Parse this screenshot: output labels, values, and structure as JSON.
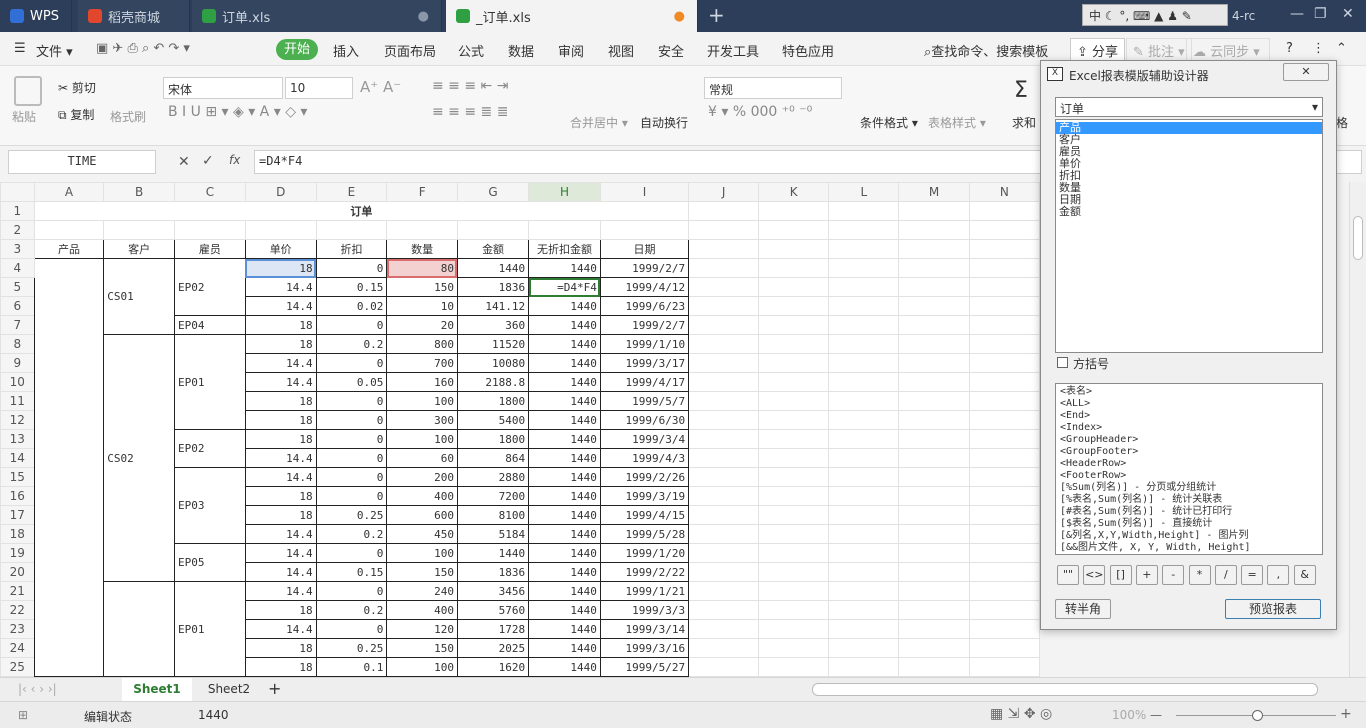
{
  "tabs": [
    {
      "label": "WPS",
      "color": "#2f6fd6"
    },
    {
      "label": "稻壳商城",
      "color": "#e0472c"
    },
    {
      "label": "订单.xls",
      "color": "#2ea043"
    },
    {
      "label": "_订单.xls",
      "color": "#2ea043"
    }
  ],
  "titlebar_right": "4-rc",
  "ime_label": "中",
  "menu": [
    "文件",
    "开始",
    "插入",
    "页面布局",
    "公式",
    "数据",
    "审阅",
    "视图",
    "安全",
    "开发工具",
    "特色应用"
  ],
  "search_label": "查找命令、搜索模板",
  "share_label": "分享",
  "comment_label": "批注",
  "cloud_label": "云同步",
  "ribbon": {
    "paste": "粘贴",
    "cut": "剪切",
    "copy": "复制",
    "format_painter": "格式刷",
    "font_name": "宋体",
    "font_size": "10",
    "merge": "合并居中",
    "wrap": "自动换行",
    "number_format": "常规",
    "cond_format": "条件格式",
    "table_style": "表格样式",
    "sum": "求和",
    "side_label": "格"
  },
  "formula": {
    "name_box": "TIME",
    "fx": "fx",
    "content": "=D4*F4"
  },
  "columns": [
    "A",
    "B",
    "C",
    "D",
    "E",
    "F",
    "G",
    "H",
    "I",
    "J",
    "K",
    "L",
    "M",
    "N"
  ],
  "sheet": {
    "title": "订单",
    "headers": [
      "产品",
      "客户",
      "雇员",
      "单价",
      "折扣",
      "数量",
      "金额",
      "无折扣金额",
      "日期"
    ],
    "customers": [
      "CS01",
      "CS02"
    ],
    "employees": [
      "EP02",
      "EP04",
      "EP01",
      "EP02",
      "EP03",
      "EP05",
      "EP01"
    ],
    "rows": [
      {
        "n": "4",
        "d": "18",
        "e": "0",
        "f": "80",
        "g": "1440",
        "h": "1440",
        "i": "1999/2/7"
      },
      {
        "n": "5",
        "d": "14.4",
        "e": "0.15",
        "f": "150",
        "g": "1836",
        "h": "=D4*F4",
        "i": "1999/4/12"
      },
      {
        "n": "6",
        "d": "14.4",
        "e": "0.02",
        "f": "10",
        "g": "141.12",
        "h": "1440",
        "i": "1999/6/23"
      },
      {
        "n": "7",
        "d": "18",
        "e": "0",
        "f": "20",
        "g": "360",
        "h": "1440",
        "i": "1999/2/7"
      },
      {
        "n": "8",
        "d": "18",
        "e": "0.2",
        "f": "800",
        "g": "11520",
        "h": "1440",
        "i": "1999/1/10"
      },
      {
        "n": "9",
        "d": "14.4",
        "e": "0",
        "f": "700",
        "g": "10080",
        "h": "1440",
        "i": "1999/3/17"
      },
      {
        "n": "10",
        "d": "14.4",
        "e": "0.05",
        "f": "160",
        "g": "2188.8",
        "h": "1440",
        "i": "1999/4/17"
      },
      {
        "n": "11",
        "d": "18",
        "e": "0",
        "f": "100",
        "g": "1800",
        "h": "1440",
        "i": "1999/5/7"
      },
      {
        "n": "12",
        "d": "18",
        "e": "0",
        "f": "300",
        "g": "5400",
        "h": "1440",
        "i": "1999/6/30"
      },
      {
        "n": "13",
        "d": "18",
        "e": "0",
        "f": "100",
        "g": "1800",
        "h": "1440",
        "i": "1999/3/4"
      },
      {
        "n": "14",
        "d": "14.4",
        "e": "0",
        "f": "60",
        "g": "864",
        "h": "1440",
        "i": "1999/4/3"
      },
      {
        "n": "15",
        "d": "14.4",
        "e": "0",
        "f": "200",
        "g": "2880",
        "h": "1440",
        "i": "1999/2/26"
      },
      {
        "n": "16",
        "d": "18",
        "e": "0",
        "f": "400",
        "g": "7200",
        "h": "1440",
        "i": "1999/3/19"
      },
      {
        "n": "17",
        "d": "18",
        "e": "0.25",
        "f": "600",
        "g": "8100",
        "h": "1440",
        "i": "1999/4/15"
      },
      {
        "n": "18",
        "d": "14.4",
        "e": "0.2",
        "f": "450",
        "g": "5184",
        "h": "1440",
        "i": "1999/5/28"
      },
      {
        "n": "19",
        "d": "14.4",
        "e": "0",
        "f": "100",
        "g": "1440",
        "h": "1440",
        "i": "1999/1/20"
      },
      {
        "n": "20",
        "d": "14.4",
        "e": "0.15",
        "f": "150",
        "g": "1836",
        "h": "1440",
        "i": "1999/2/22"
      },
      {
        "n": "21",
        "d": "14.4",
        "e": "0",
        "f": "240",
        "g": "3456",
        "h": "1440",
        "i": "1999/1/21"
      },
      {
        "n": "22",
        "d": "18",
        "e": "0.2",
        "f": "400",
        "g": "5760",
        "h": "1440",
        "i": "1999/3/3"
      },
      {
        "n": "23",
        "d": "14.4",
        "e": "0",
        "f": "120",
        "g": "1728",
        "h": "1440",
        "i": "1999/3/14"
      },
      {
        "n": "24",
        "d": "18",
        "e": "0.25",
        "f": "150",
        "g": "2025",
        "h": "1440",
        "i": "1999/3/16"
      },
      {
        "n": "25",
        "d": "18",
        "e": "0.1",
        "f": "100",
        "g": "1620",
        "h": "1440",
        "i": "1999/5/27"
      }
    ]
  },
  "sheet_tabs": [
    "Sheet1",
    "Sheet2"
  ],
  "status": {
    "mode": "编辑状态",
    "value": "1440",
    "zoom": "100%"
  },
  "dialog": {
    "title": "Excel报表模版辅助设计器",
    "table_select": "订单",
    "fields": [
      "产品",
      "客户",
      "雇员",
      "单价",
      "折扣",
      "数量",
      "日期",
      "金额"
    ],
    "bracket_label": "方括号",
    "templates": [
      "<表名>",
      "<ALL>",
      "<End>",
      "<Index>",
      "<GroupHeader>",
      "<GroupFooter>",
      "<HeaderRow>",
      "<FooterRow>",
      "[%Sum(列名)] - 分页或分组统计",
      "[%表名,Sum(列名)] - 统计关联表",
      "[#表名,Sum(列名)] - 统计已打印行",
      "[$表名,Sum(列名)] - 直接统计",
      "[&列名,X,Y,Width,Height] - 图片列",
      "[&&图片文件, X, Y, Width, Height]"
    ],
    "symbols": [
      "\"\"",
      "<>",
      "[]",
      "+",
      "-",
      "*",
      "/",
      "=",
      ",",
      "&"
    ],
    "half_btn": "转半角",
    "preview_btn": "预览报表"
  }
}
